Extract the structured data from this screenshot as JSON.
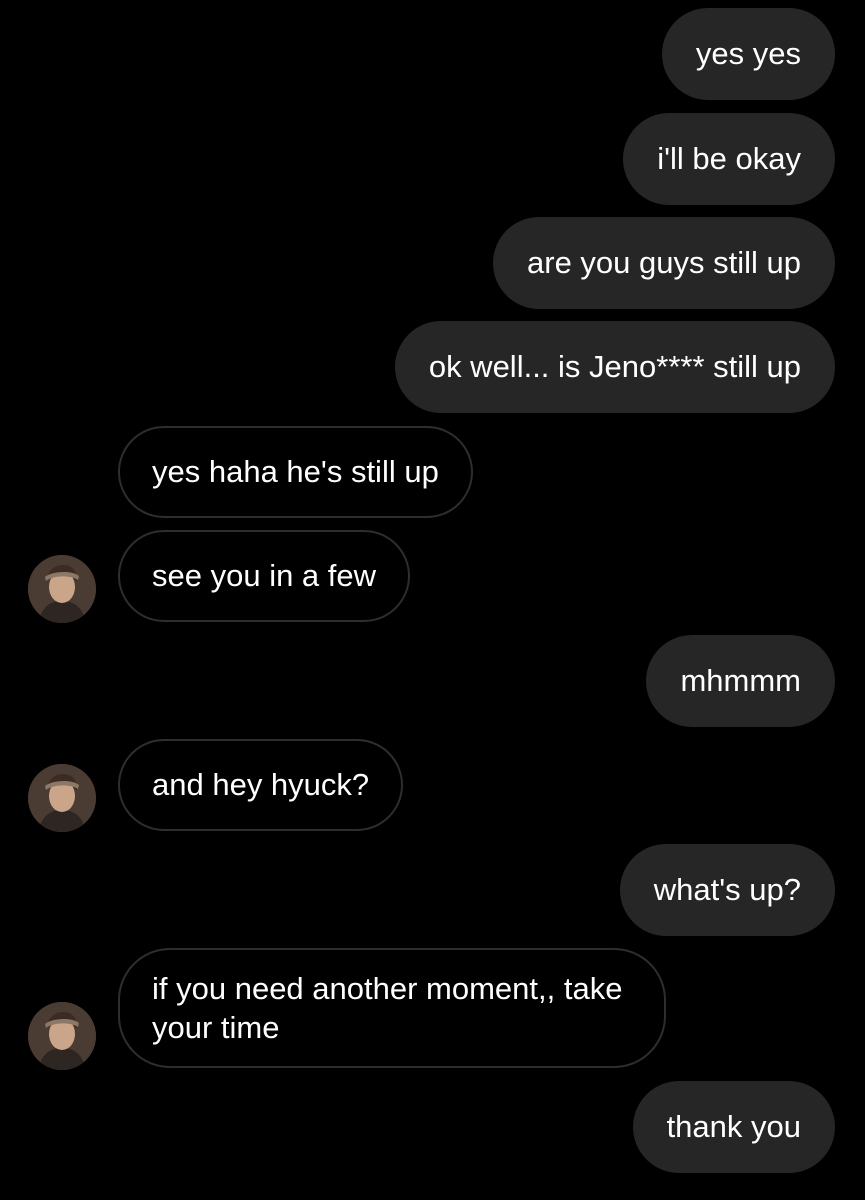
{
  "messages": [
    {
      "from": "me",
      "text": "yes yes"
    },
    {
      "from": "me",
      "text": "i'll be okay"
    },
    {
      "from": "me",
      "text": "are you guys still up"
    },
    {
      "from": "me",
      "text": "ok well... is Jeno**** still up"
    },
    {
      "from": "them",
      "text": "yes haha he's still up"
    },
    {
      "from": "them",
      "text": "see you in a few"
    },
    {
      "from": "me",
      "text": "mhmmm"
    },
    {
      "from": "them",
      "text": "and hey hyuck?"
    },
    {
      "from": "me",
      "text": "what's up?"
    },
    {
      "from": "them",
      "text": "if you need another moment,, take your time"
    },
    {
      "from": "me",
      "text": "thank you"
    }
  ],
  "colors": {
    "background": "#000000",
    "sent_bubble": "#262626",
    "received_border": "#2e2e2e",
    "text": "#ffffff"
  },
  "avatar_icon": "profile-photo-icon"
}
